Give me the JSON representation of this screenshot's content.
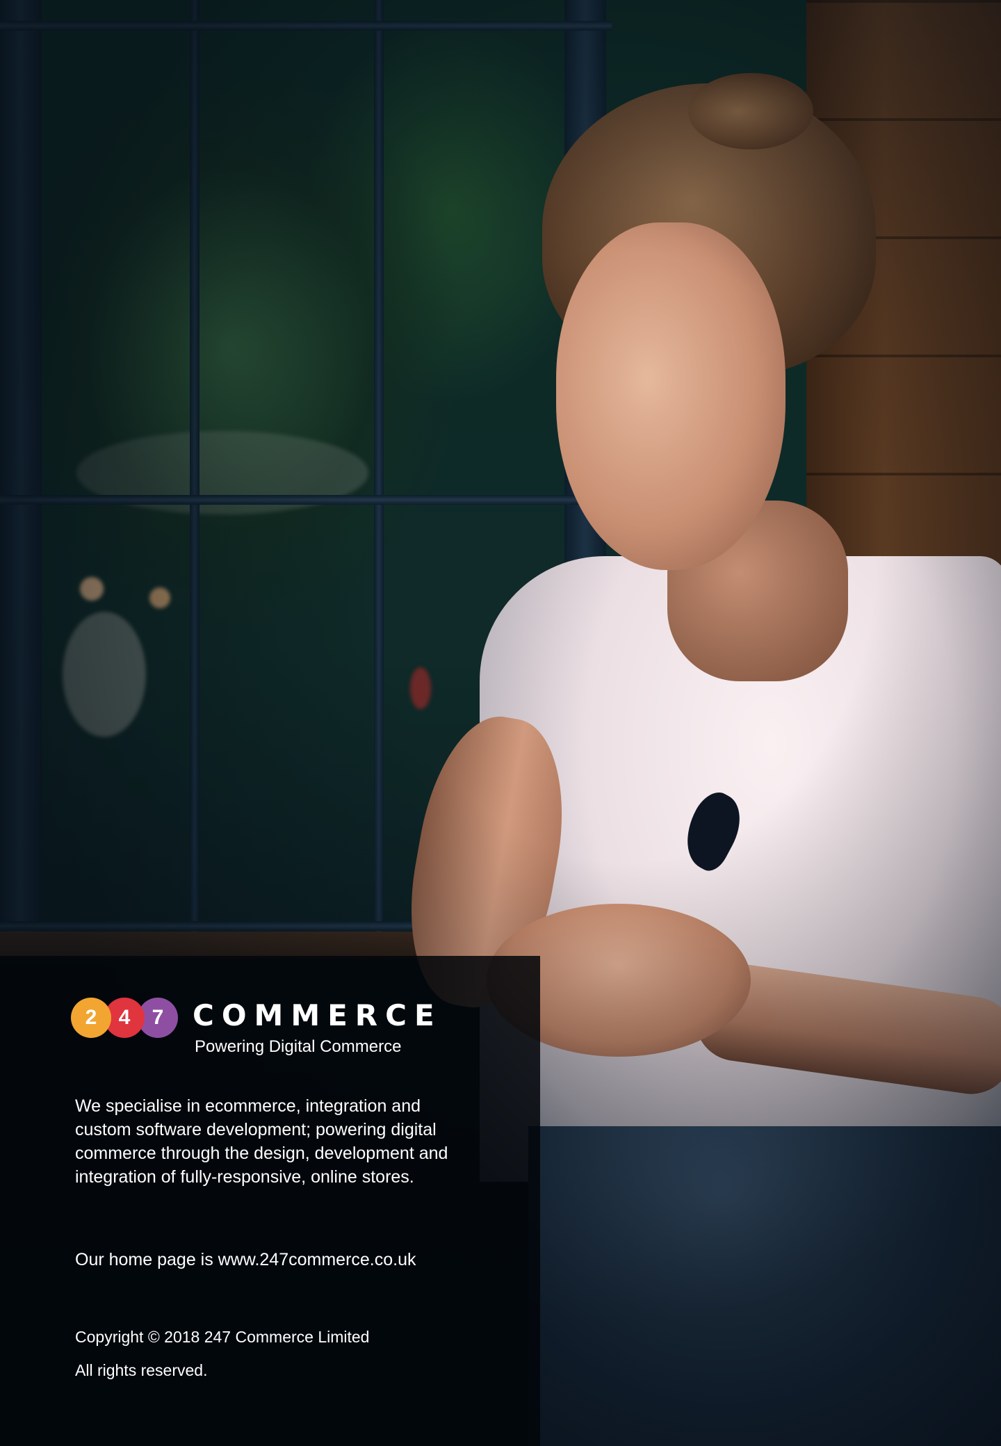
{
  "logo": {
    "digits": [
      "2",
      "4",
      "7"
    ],
    "colors": [
      "#f2a531",
      "#e0343f",
      "#8e4fa3"
    ],
    "name": "COMMERCE",
    "tagline": "Powering Digital Commerce"
  },
  "content": {
    "description": "We specialise in ecommerce, integration and custom software development; powering digital commerce through the design, development and integration of fully-responsive, online stores.",
    "homepage": "Our home page is www.247commerce.co.uk",
    "copyright": "Copyright © 2018 247 Commerce Limited",
    "rights": "All rights reserved."
  },
  "colors": {
    "panel_background": "#02060a",
    "text": "#ffffff"
  }
}
